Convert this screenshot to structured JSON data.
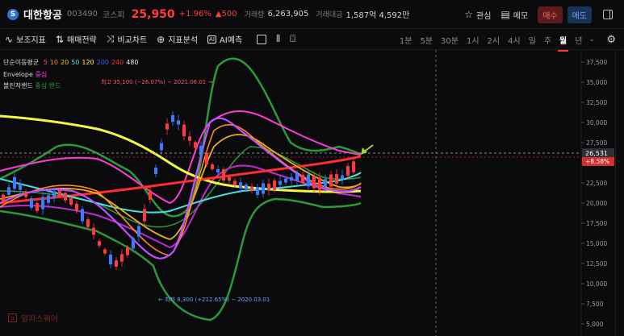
{
  "stock": {
    "logo_letter": "S",
    "name": "대한항공",
    "code": "003490",
    "market": "코스피",
    "price": "25,950",
    "change_pct": "+1.96%",
    "change_abs": "▲500",
    "volume_label": "거래량",
    "volume": "6,263,905",
    "amount_label": "거래대금",
    "amount": "1,587억 4,592만"
  },
  "header_actions": {
    "watch_label": "관심",
    "memo_label": "메모",
    "buy_label": "매수",
    "sell_label": "매도"
  },
  "toolbar": {
    "aux_indicator": "보조지표",
    "trade_strategy": "매매전략",
    "compare_chart": "비교차트",
    "indicator_analysis": "지표분석",
    "ai_predict": "AI예측",
    "ai_badge": "AI"
  },
  "periods": [
    "1분",
    "5분",
    "30분",
    "1시",
    "2시",
    "4시",
    "일",
    "주",
    "월",
    "년"
  ],
  "active_period": "월",
  "legend": {
    "sma_label": "단순이동평균",
    "sma_periods": [
      {
        "text": "5",
        "color": "#ff4fa3"
      },
      {
        "text": "10",
        "color": "#ff8a1f"
      },
      {
        "text": "20",
        "color": "#e6d21d"
      },
      {
        "text": "50",
        "color": "#42e0e0"
      },
      {
        "text": "120",
        "color": "#f5f542"
      },
      {
        "text": "200",
        "color": "#3a5bff"
      },
      {
        "text": "240",
        "color": "#ff2d2d"
      },
      {
        "text": "480",
        "color": "#e8e8e8"
      }
    ],
    "envelope_label": "Envelope",
    "envelope_sub": "중심",
    "bollinger_label": "볼린저밴드",
    "bollinger_sub": "중심 밴드"
  },
  "annotations": {
    "high": "최고 35,100 (−26.07%) − 2021.06.01 →",
    "low": "← 최저 8,300 (+212.65%) − 2020.03.01"
  },
  "price_axis": {
    "ticks": [
      "37,500",
      "35,000",
      "32,500",
      "30,000",
      "27,500",
      "25,000",
      "22,500",
      "20,000",
      "17,500",
      "15,000",
      "12,500",
      "10,000",
      "7,500",
      "5,000"
    ],
    "crosshair_label": "26,531",
    "current_label": "+8.58%"
  },
  "watermark": "알파스퀘어",
  "watermark_icon": "α",
  "colors": {
    "up": "#ff3b3b",
    "down": "#3a7bff",
    "accent": "#ff3b3b"
  },
  "chart_data": {
    "type": "line",
    "ylim": [
      5000,
      37500
    ],
    "series": [
      {
        "name": "120",
        "color": "#f5f542",
        "values": [
          30500,
          30000,
          29000,
          28100,
          27200,
          25800,
          24200,
          23200,
          22500,
          22200,
          22000,
          21800
        ]
      },
      {
        "name": "240",
        "color": "#ff2d2d",
        "values": [
          20600,
          21000,
          21500,
          22000,
          22600,
          23300,
          24000,
          24600,
          25200,
          25700,
          26000,
          26400
        ]
      },
      {
        "name": "5",
        "color": "#ff4fa3",
        "values": [
          22000,
          23000,
          19000,
          16000,
          12000,
          14000,
          25000,
          30000,
          29000,
          25000,
          22500,
          23500
        ]
      },
      {
        "name": "50",
        "color": "#42e0e0",
        "values": [
          22600,
          22200,
          21500,
          20600,
          20000,
          20400,
          21800,
          22800,
          23000,
          22800,
          23200,
          24400
        ]
      }
    ]
  }
}
